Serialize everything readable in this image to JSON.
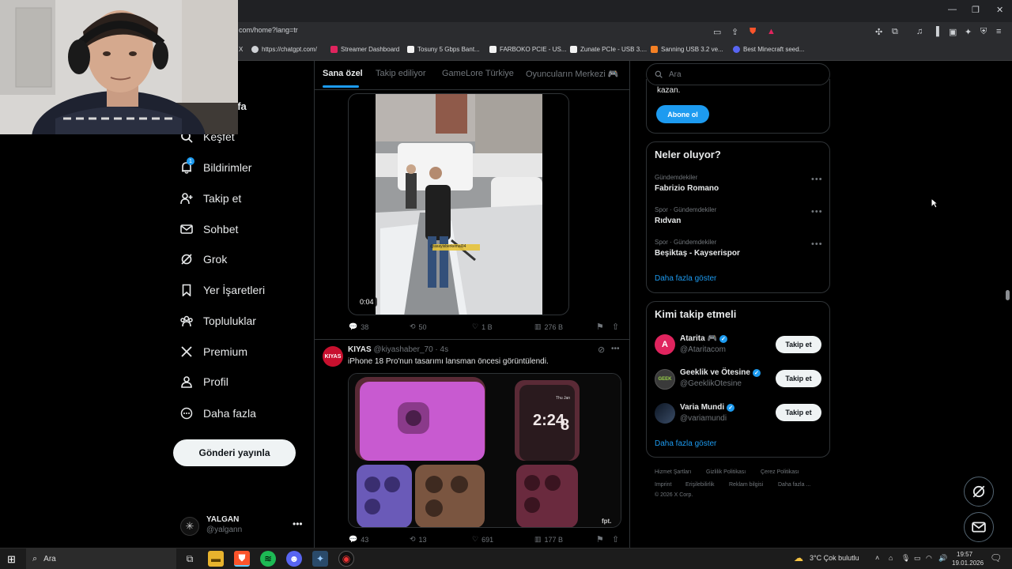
{
  "browser": {
    "url": "com/home?lang=tr",
    "tab_title_fragment": "X",
    "bookmarks": [
      {
        "label": "https://chatgpt.com/",
        "color": "#cfd2d6"
      },
      {
        "label": "Streamer Dashboard",
        "color": "#e0245e"
      },
      {
        "label": "Tosuny 5 Gbps Bant...",
        "color": "#f2f2f2"
      },
      {
        "label": "FARBOKO PCIE - US...",
        "color": "#f2f2f2"
      },
      {
        "label": "Zunate PCIe - USB 3....",
        "color": "#f2f2f2"
      },
      {
        "label": "Sanning USB 3.2 ve...",
        "color": "#f48024"
      },
      {
        "label": "Best Minecraft seed...",
        "color": "#5865f2"
      }
    ]
  },
  "sidebar": {
    "partial_top_label": "yfa",
    "items": [
      {
        "label": "Keşfet",
        "icon": "search-icon",
        "glyph": "⌕"
      },
      {
        "label": "Bildirimler",
        "icon": "bell-icon",
        "glyph": "🔔",
        "badge": "1"
      },
      {
        "label": "Takip et",
        "icon": "person-add-icon",
        "glyph": "👤"
      },
      {
        "label": "Sohbet",
        "icon": "envelope-icon",
        "glyph": "✉"
      },
      {
        "label": "Grok",
        "icon": "grok-icon",
        "glyph": "⊘"
      },
      {
        "label": "Yer İşaretleri",
        "icon": "bookmark-icon",
        "glyph": "🔖"
      },
      {
        "label": "Topluluklar",
        "icon": "communities-icon",
        "glyph": "👥"
      },
      {
        "label": "Premium",
        "icon": "x-logo-icon",
        "glyph": "𝕏"
      },
      {
        "label": "Profil",
        "icon": "profile-icon",
        "glyph": "👤"
      },
      {
        "label": "Daha fazla",
        "icon": "more-circle-icon",
        "glyph": "⋯"
      }
    ],
    "post_button": "Gönderi yayınla",
    "account": {
      "name": "YALGAN",
      "handle": "@yalgann"
    }
  },
  "tabs": [
    "Sana özel",
    "Takip ediliyor",
    "GameLore Türkiye",
    "Oyuncuların Merkezi 🎮"
  ],
  "post1": {
    "video_time": "0:04",
    "watermark": "@asayisberkemal34",
    "replies": "38",
    "reposts": "50",
    "likes": "1 B",
    "views": "276 B"
  },
  "post2": {
    "avatar_text": "KIYAS",
    "name": "KIYAS",
    "handle": "@kiyashaber_70",
    "time": "· 4s",
    "text": "iPhone 18 Pro'nun tasarımı lansman öncesi görüntülendi.",
    "image_clock": "2:24",
    "image_date": "8",
    "image_date_header": "Thu Jan",
    "image_watermark": "fpt.",
    "replies": "43",
    "reposts": "13",
    "likes": "691",
    "views": "177 B"
  },
  "right": {
    "search_placeholder": "Ara",
    "premium_tail": "kazan.",
    "subscribe_button": "Abone ol",
    "trends_title": "Neler oluyor?",
    "trends": [
      {
        "context": "Gündemdekiler",
        "name": "Fabrizio Romano"
      },
      {
        "context": "Spor · Gündemdekiler",
        "name": "Rıdvan"
      },
      {
        "context": "Spor · Gündemdekiler",
        "name": "Beşiktaş - Kayserispor"
      }
    ],
    "trends_more": "Daha fazla göster",
    "wtf_title": "Kimi takip etmeli",
    "wtf": [
      {
        "name": "Atarita 🎮",
        "handle": "@Ataritacom",
        "button": "Takip et",
        "avatar_color": "#e0245e"
      },
      {
        "name": "Geeklik ve Ötesine",
        "handle": "@GeeklikOtesine",
        "button": "Takip et",
        "avatar_color": "#3a3a3a"
      },
      {
        "name": "Varia Mundi",
        "handle": "@variamundi",
        "button": "Takip et",
        "avatar_color": "#1b2a3a"
      }
    ],
    "wtf_more": "Daha fazla göster",
    "footer": [
      "Hizmet Şartları",
      "Gizlilik Politikası",
      "Çerez Politikası",
      "Imprint",
      "Erişilebilirlik",
      "Reklam bilgisi",
      "Daha fazla ...",
      "© 2026 X Corp."
    ]
  },
  "taskbar": {
    "search": "Ara",
    "weather": "3°C  Çok bulutlu",
    "time": "19:57",
    "date": "19.01.2026"
  },
  "colors": {
    "accent": "#1d9bf0",
    "background": "#000000",
    "border": "#2f3336",
    "muted": "#71767b"
  }
}
